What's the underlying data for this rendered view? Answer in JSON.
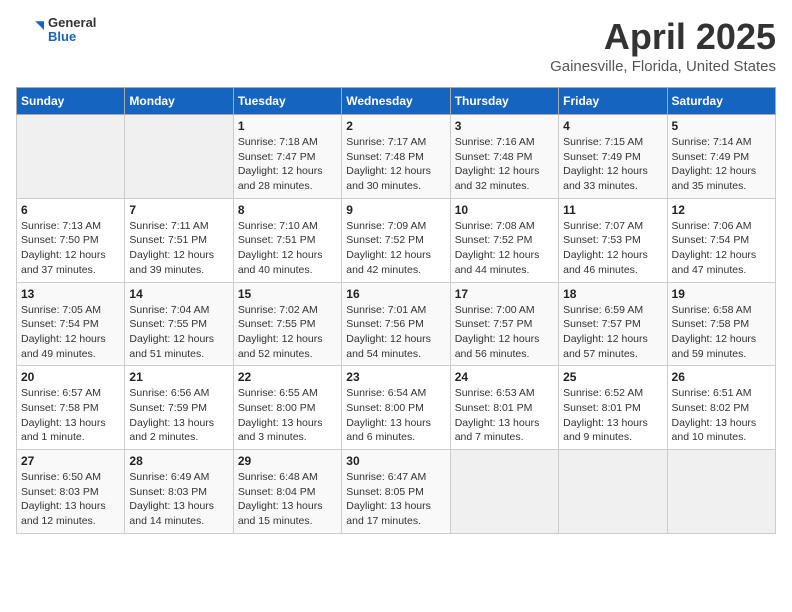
{
  "header": {
    "logo_general": "General",
    "logo_blue": "Blue",
    "title": "April 2025",
    "subtitle": "Gainesville, Florida, United States"
  },
  "days_of_week": [
    "Sunday",
    "Monday",
    "Tuesday",
    "Wednesday",
    "Thursday",
    "Friday",
    "Saturday"
  ],
  "weeks": [
    [
      {
        "day": "",
        "text": ""
      },
      {
        "day": "",
        "text": ""
      },
      {
        "day": "1",
        "text": "Sunrise: 7:18 AM\nSunset: 7:47 PM\nDaylight: 12 hours and 28 minutes."
      },
      {
        "day": "2",
        "text": "Sunrise: 7:17 AM\nSunset: 7:48 PM\nDaylight: 12 hours and 30 minutes."
      },
      {
        "day": "3",
        "text": "Sunrise: 7:16 AM\nSunset: 7:48 PM\nDaylight: 12 hours and 32 minutes."
      },
      {
        "day": "4",
        "text": "Sunrise: 7:15 AM\nSunset: 7:49 PM\nDaylight: 12 hours and 33 minutes."
      },
      {
        "day": "5",
        "text": "Sunrise: 7:14 AM\nSunset: 7:49 PM\nDaylight: 12 hours and 35 minutes."
      }
    ],
    [
      {
        "day": "6",
        "text": "Sunrise: 7:13 AM\nSunset: 7:50 PM\nDaylight: 12 hours and 37 minutes."
      },
      {
        "day": "7",
        "text": "Sunrise: 7:11 AM\nSunset: 7:51 PM\nDaylight: 12 hours and 39 minutes."
      },
      {
        "day": "8",
        "text": "Sunrise: 7:10 AM\nSunset: 7:51 PM\nDaylight: 12 hours and 40 minutes."
      },
      {
        "day": "9",
        "text": "Sunrise: 7:09 AM\nSunset: 7:52 PM\nDaylight: 12 hours and 42 minutes."
      },
      {
        "day": "10",
        "text": "Sunrise: 7:08 AM\nSunset: 7:52 PM\nDaylight: 12 hours and 44 minutes."
      },
      {
        "day": "11",
        "text": "Sunrise: 7:07 AM\nSunset: 7:53 PM\nDaylight: 12 hours and 46 minutes."
      },
      {
        "day": "12",
        "text": "Sunrise: 7:06 AM\nSunset: 7:54 PM\nDaylight: 12 hours and 47 minutes."
      }
    ],
    [
      {
        "day": "13",
        "text": "Sunrise: 7:05 AM\nSunset: 7:54 PM\nDaylight: 12 hours and 49 minutes."
      },
      {
        "day": "14",
        "text": "Sunrise: 7:04 AM\nSunset: 7:55 PM\nDaylight: 12 hours and 51 minutes."
      },
      {
        "day": "15",
        "text": "Sunrise: 7:02 AM\nSunset: 7:55 PM\nDaylight: 12 hours and 52 minutes."
      },
      {
        "day": "16",
        "text": "Sunrise: 7:01 AM\nSunset: 7:56 PM\nDaylight: 12 hours and 54 minutes."
      },
      {
        "day": "17",
        "text": "Sunrise: 7:00 AM\nSunset: 7:57 PM\nDaylight: 12 hours and 56 minutes."
      },
      {
        "day": "18",
        "text": "Sunrise: 6:59 AM\nSunset: 7:57 PM\nDaylight: 12 hours and 57 minutes."
      },
      {
        "day": "19",
        "text": "Sunrise: 6:58 AM\nSunset: 7:58 PM\nDaylight: 12 hours and 59 minutes."
      }
    ],
    [
      {
        "day": "20",
        "text": "Sunrise: 6:57 AM\nSunset: 7:58 PM\nDaylight: 13 hours and 1 minute."
      },
      {
        "day": "21",
        "text": "Sunrise: 6:56 AM\nSunset: 7:59 PM\nDaylight: 13 hours and 2 minutes."
      },
      {
        "day": "22",
        "text": "Sunrise: 6:55 AM\nSunset: 8:00 PM\nDaylight: 13 hours and 3 minutes."
      },
      {
        "day": "23",
        "text": "Sunrise: 6:54 AM\nSunset: 8:00 PM\nDaylight: 13 hours and 6 minutes."
      },
      {
        "day": "24",
        "text": "Sunrise: 6:53 AM\nSunset: 8:01 PM\nDaylight: 13 hours and 7 minutes."
      },
      {
        "day": "25",
        "text": "Sunrise: 6:52 AM\nSunset: 8:01 PM\nDaylight: 13 hours and 9 minutes."
      },
      {
        "day": "26",
        "text": "Sunrise: 6:51 AM\nSunset: 8:02 PM\nDaylight: 13 hours and 10 minutes."
      }
    ],
    [
      {
        "day": "27",
        "text": "Sunrise: 6:50 AM\nSunset: 8:03 PM\nDaylight: 13 hours and 12 minutes."
      },
      {
        "day": "28",
        "text": "Sunrise: 6:49 AM\nSunset: 8:03 PM\nDaylight: 13 hours and 14 minutes."
      },
      {
        "day": "29",
        "text": "Sunrise: 6:48 AM\nSunset: 8:04 PM\nDaylight: 13 hours and 15 minutes."
      },
      {
        "day": "30",
        "text": "Sunrise: 6:47 AM\nSunset: 8:05 PM\nDaylight: 13 hours and 17 minutes."
      },
      {
        "day": "",
        "text": ""
      },
      {
        "day": "",
        "text": ""
      },
      {
        "day": "",
        "text": ""
      }
    ]
  ]
}
